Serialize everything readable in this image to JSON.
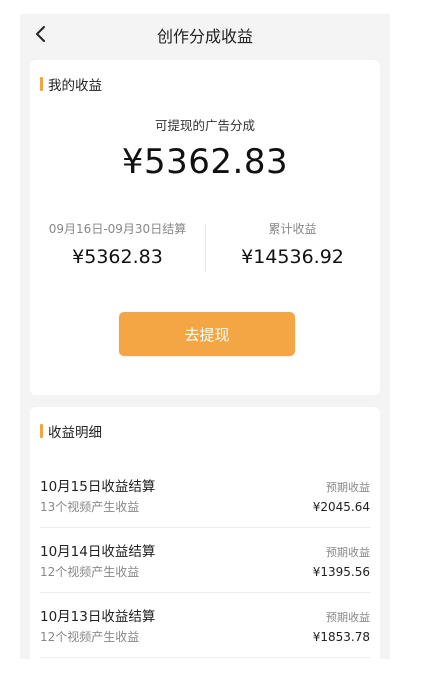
{
  "nav": {
    "title": "创作分成收益",
    "back_icon": "chevron-left-icon"
  },
  "earnings": {
    "section_title": "我的收益",
    "withdrawable_label": "可提现的广告分成",
    "withdrawable_amount": "¥5362.83",
    "period_label": "09月16日-09月30日结算",
    "period_amount": "¥5362.83",
    "total_label": "累计收益",
    "total_amount": "¥14536.92",
    "withdraw_button": "去提现"
  },
  "details": {
    "section_title": "收益明细",
    "rows": [
      {
        "title": "10月15日收益结算",
        "subtitle": "13个视频产生收益",
        "label": "预期收益",
        "amount": "¥2045.64"
      },
      {
        "title": "10月14日收益结算",
        "subtitle": "12个视频产生收益",
        "label": "预期收益",
        "amount": "¥1395.56"
      },
      {
        "title": "10月13日收益结算",
        "subtitle": "12个视频产生收益",
        "label": "预期收益",
        "amount": "¥1853.78"
      }
    ]
  },
  "colors": {
    "accent": "#f4a544",
    "background": "#f4f4f4",
    "card": "#ffffff"
  }
}
